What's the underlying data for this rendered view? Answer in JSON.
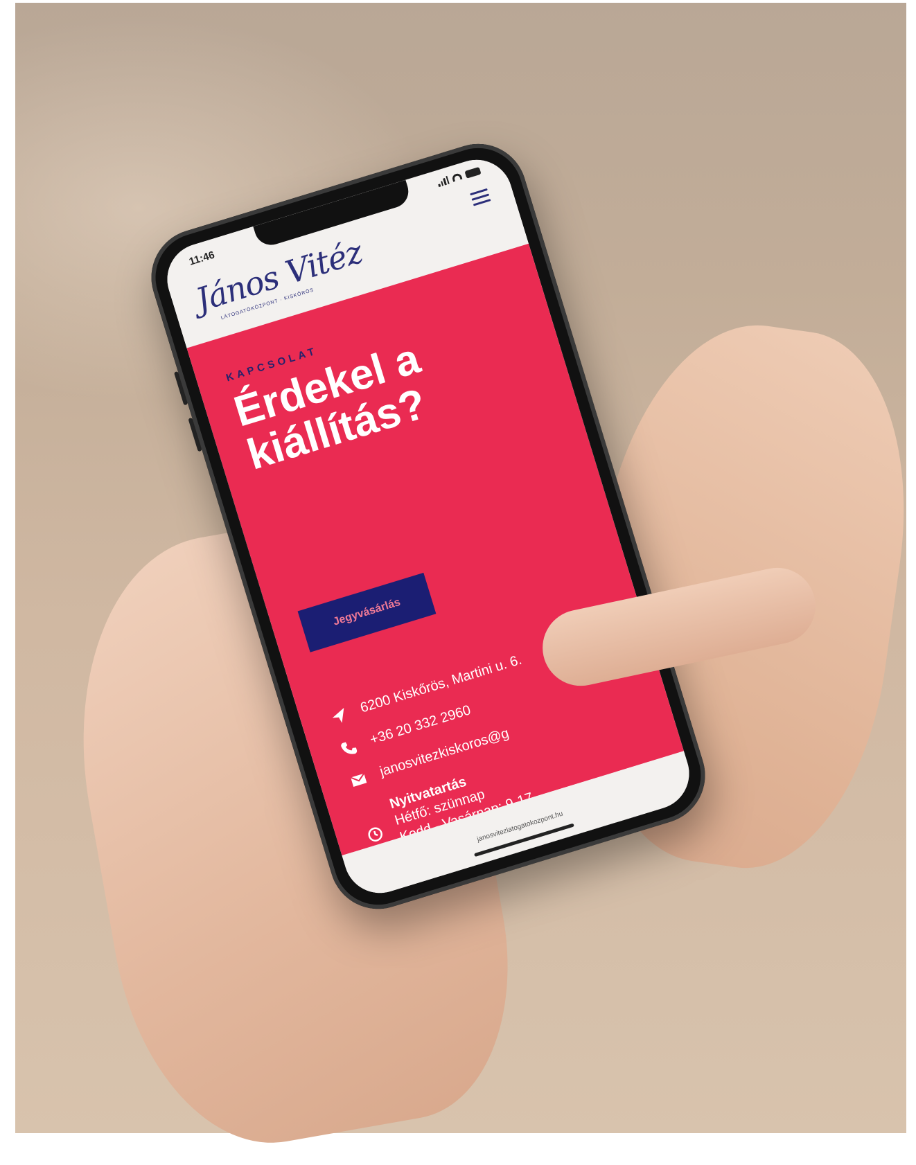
{
  "status_bar": {
    "time": "11:46"
  },
  "header": {
    "logo_text": "János Vitéz",
    "logo_subtitle": "LÁTOGATÓKÖZPONT · KISKŐRÖS",
    "menu_icon": "hamburger-menu-icon"
  },
  "hero": {
    "eyebrow": "KAPCSOLAT",
    "headline": "Érdekel a kiállítás?",
    "cta_label": "Jegyvásárlás"
  },
  "contact": {
    "address": "6200 Kiskőrös, Martini u. 6.",
    "phone": "+36 20 332 2960",
    "email": "janosvitezkiskoros@g",
    "hours_title": "Nyitvatartás",
    "hours_line1": "Hétfő: szünnap",
    "hours_line2": "Kedd - Vasárnap: 9-17"
  },
  "browser": {
    "url": "janosvitezlatogatokozpont.hu"
  },
  "colors": {
    "brand_pink": "#ea2b52",
    "brand_navy": "#1b1e73",
    "cta_text": "#f07a96"
  }
}
